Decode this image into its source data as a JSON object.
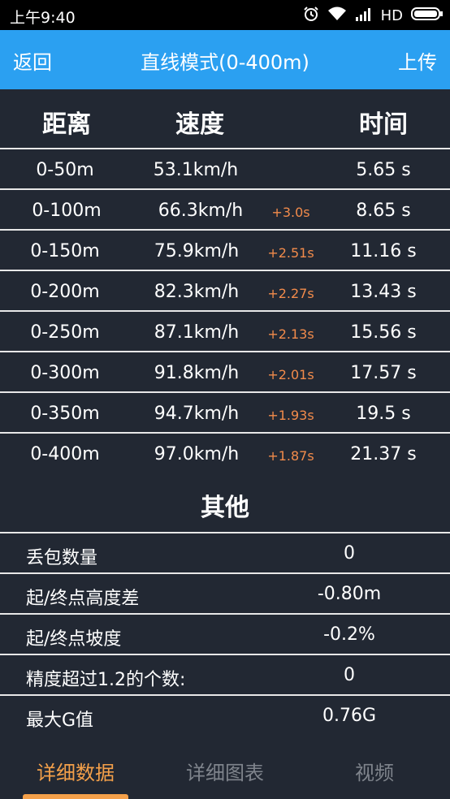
{
  "status_bar": {
    "time": "上午9:40",
    "network_label": "HD"
  },
  "header": {
    "back_label": "返回",
    "title": "直线模式(0-400m)",
    "upload_label": "上传"
  },
  "table": {
    "columns": [
      "距离",
      "速度",
      "时间"
    ],
    "rows": [
      {
        "distance": "0-50m",
        "speed": "53.1km/h",
        "delta": "",
        "time": "5.65 s"
      },
      {
        "distance": "0-100m",
        "speed": "66.3km/h",
        "delta": "+3.0s",
        "time": "8.65 s"
      },
      {
        "distance": "0-150m",
        "speed": "75.9km/h",
        "delta": "+2.51s",
        "time": "11.16 s"
      },
      {
        "distance": "0-200m",
        "speed": "82.3km/h",
        "delta": "+2.27s",
        "time": "13.43 s"
      },
      {
        "distance": "0-250m",
        "speed": "87.1km/h",
        "delta": "+2.13s",
        "time": "15.56 s"
      },
      {
        "distance": "0-300m",
        "speed": "91.8km/h",
        "delta": "+2.01s",
        "time": "17.57 s"
      },
      {
        "distance": "0-350m",
        "speed": "94.7km/h",
        "delta": "+1.93s",
        "time": "19.5 s"
      },
      {
        "distance": "0-400m",
        "speed": "97.0km/h",
        "delta": "+1.87s",
        "time": "21.37 s"
      }
    ],
    "delta_color": "#f28b4b"
  },
  "other": {
    "title": "其他",
    "items": [
      {
        "label": "丢包数量",
        "value": "0"
      },
      {
        "label": "起/终点高度差",
        "value": "-0.80m"
      },
      {
        "label": "起/终点坡度",
        "value": "-0.2%"
      },
      {
        "label": "精度超过1.2的个数:",
        "value": "0"
      },
      {
        "label": "最大G值",
        "value": "0.76G"
      }
    ]
  },
  "tabs": {
    "items": [
      "详细数据",
      "详细图表",
      "视频"
    ],
    "active": "详细数据",
    "active_color": "#f4a04a"
  },
  "colors": {
    "header": "#2ba0f1",
    "background": "#222833",
    "status_bar": "#000000"
  },
  "icons": [
    "alarm-icon",
    "wifi-icon",
    "signal-icon",
    "battery-icon"
  ]
}
